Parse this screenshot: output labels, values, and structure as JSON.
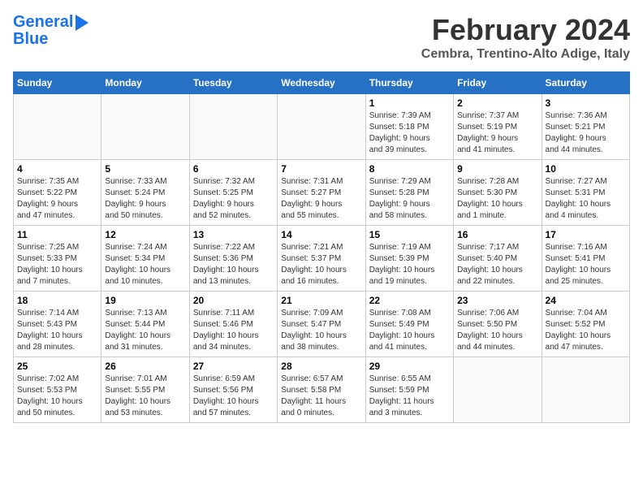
{
  "logo": {
    "line1": "General",
    "line2": "Blue"
  },
  "title": "February 2024",
  "subtitle": "Cembra, Trentino-Alto Adige, Italy",
  "days_of_week": [
    "Sunday",
    "Monday",
    "Tuesday",
    "Wednesday",
    "Thursday",
    "Friday",
    "Saturday"
  ],
  "weeks": [
    [
      {
        "day": "",
        "info": ""
      },
      {
        "day": "",
        "info": ""
      },
      {
        "day": "",
        "info": ""
      },
      {
        "day": "",
        "info": ""
      },
      {
        "day": "1",
        "info": "Sunrise: 7:39 AM\nSunset: 5:18 PM\nDaylight: 9 hours\nand 39 minutes."
      },
      {
        "day": "2",
        "info": "Sunrise: 7:37 AM\nSunset: 5:19 PM\nDaylight: 9 hours\nand 41 minutes."
      },
      {
        "day": "3",
        "info": "Sunrise: 7:36 AM\nSunset: 5:21 PM\nDaylight: 9 hours\nand 44 minutes."
      }
    ],
    [
      {
        "day": "4",
        "info": "Sunrise: 7:35 AM\nSunset: 5:22 PM\nDaylight: 9 hours\nand 47 minutes."
      },
      {
        "day": "5",
        "info": "Sunrise: 7:33 AM\nSunset: 5:24 PM\nDaylight: 9 hours\nand 50 minutes."
      },
      {
        "day": "6",
        "info": "Sunrise: 7:32 AM\nSunset: 5:25 PM\nDaylight: 9 hours\nand 52 minutes."
      },
      {
        "day": "7",
        "info": "Sunrise: 7:31 AM\nSunset: 5:27 PM\nDaylight: 9 hours\nand 55 minutes."
      },
      {
        "day": "8",
        "info": "Sunrise: 7:29 AM\nSunset: 5:28 PM\nDaylight: 9 hours\nand 58 minutes."
      },
      {
        "day": "9",
        "info": "Sunrise: 7:28 AM\nSunset: 5:30 PM\nDaylight: 10 hours\nand 1 minute."
      },
      {
        "day": "10",
        "info": "Sunrise: 7:27 AM\nSunset: 5:31 PM\nDaylight: 10 hours\nand 4 minutes."
      }
    ],
    [
      {
        "day": "11",
        "info": "Sunrise: 7:25 AM\nSunset: 5:33 PM\nDaylight: 10 hours\nand 7 minutes."
      },
      {
        "day": "12",
        "info": "Sunrise: 7:24 AM\nSunset: 5:34 PM\nDaylight: 10 hours\nand 10 minutes."
      },
      {
        "day": "13",
        "info": "Sunrise: 7:22 AM\nSunset: 5:36 PM\nDaylight: 10 hours\nand 13 minutes."
      },
      {
        "day": "14",
        "info": "Sunrise: 7:21 AM\nSunset: 5:37 PM\nDaylight: 10 hours\nand 16 minutes."
      },
      {
        "day": "15",
        "info": "Sunrise: 7:19 AM\nSunset: 5:39 PM\nDaylight: 10 hours\nand 19 minutes."
      },
      {
        "day": "16",
        "info": "Sunrise: 7:17 AM\nSunset: 5:40 PM\nDaylight: 10 hours\nand 22 minutes."
      },
      {
        "day": "17",
        "info": "Sunrise: 7:16 AM\nSunset: 5:41 PM\nDaylight: 10 hours\nand 25 minutes."
      }
    ],
    [
      {
        "day": "18",
        "info": "Sunrise: 7:14 AM\nSunset: 5:43 PM\nDaylight: 10 hours\nand 28 minutes."
      },
      {
        "day": "19",
        "info": "Sunrise: 7:13 AM\nSunset: 5:44 PM\nDaylight: 10 hours\nand 31 minutes."
      },
      {
        "day": "20",
        "info": "Sunrise: 7:11 AM\nSunset: 5:46 PM\nDaylight: 10 hours\nand 34 minutes."
      },
      {
        "day": "21",
        "info": "Sunrise: 7:09 AM\nSunset: 5:47 PM\nDaylight: 10 hours\nand 38 minutes."
      },
      {
        "day": "22",
        "info": "Sunrise: 7:08 AM\nSunset: 5:49 PM\nDaylight: 10 hours\nand 41 minutes."
      },
      {
        "day": "23",
        "info": "Sunrise: 7:06 AM\nSunset: 5:50 PM\nDaylight: 10 hours\nand 44 minutes."
      },
      {
        "day": "24",
        "info": "Sunrise: 7:04 AM\nSunset: 5:52 PM\nDaylight: 10 hours\nand 47 minutes."
      }
    ],
    [
      {
        "day": "25",
        "info": "Sunrise: 7:02 AM\nSunset: 5:53 PM\nDaylight: 10 hours\nand 50 minutes."
      },
      {
        "day": "26",
        "info": "Sunrise: 7:01 AM\nSunset: 5:55 PM\nDaylight: 10 hours\nand 53 minutes."
      },
      {
        "day": "27",
        "info": "Sunrise: 6:59 AM\nSunset: 5:56 PM\nDaylight: 10 hours\nand 57 minutes."
      },
      {
        "day": "28",
        "info": "Sunrise: 6:57 AM\nSunset: 5:58 PM\nDaylight: 11 hours\nand 0 minutes."
      },
      {
        "day": "29",
        "info": "Sunrise: 6:55 AM\nSunset: 5:59 PM\nDaylight: 11 hours\nand 3 minutes."
      },
      {
        "day": "",
        "info": ""
      },
      {
        "day": "",
        "info": ""
      }
    ]
  ]
}
